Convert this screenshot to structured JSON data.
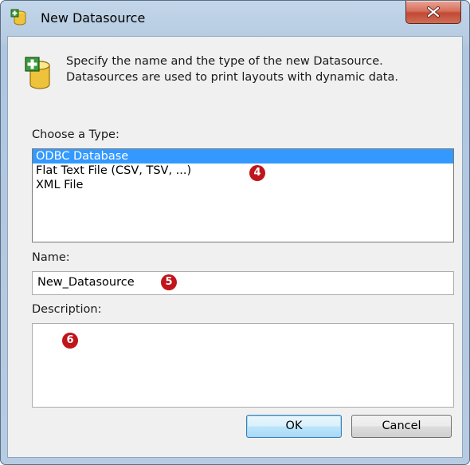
{
  "window": {
    "title": "New Datasource"
  },
  "info": {
    "text": "Specify the name and the type of the new Datasource. Datasources are used to print layouts with dynamic data."
  },
  "type_section": {
    "label": "Choose a Type:",
    "items": [
      {
        "label": "ODBC Database",
        "selected": true
      },
      {
        "label": "Flat Text File (CSV, TSV, ...)",
        "selected": false
      },
      {
        "label": "XML File",
        "selected": false
      }
    ]
  },
  "name_section": {
    "label": "Name:",
    "value": "New_Datasource"
  },
  "description_section": {
    "label": "Description:",
    "value": ""
  },
  "buttons": {
    "ok": "OK",
    "cancel": "Cancel"
  },
  "callouts": {
    "type": "4",
    "name": "5",
    "description": "6"
  },
  "colors": {
    "selection": "#3399ff",
    "callout": "#c0151b",
    "close_button": "#c24a34"
  }
}
